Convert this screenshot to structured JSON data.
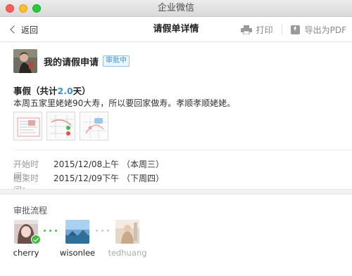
{
  "window": {
    "title": "企业微信"
  },
  "nav": {
    "back_label": "返回",
    "title": "请假单详情",
    "print_label": "打印",
    "export_label": "导出为PDF"
  },
  "applicant": {
    "title": "我的请假申请",
    "status": "审批中"
  },
  "leave": {
    "type_prefix": "事假（共计",
    "days": "2.0",
    "type_suffix": "天）",
    "reason": "本周五家里姥姥90大寿，所以要回家做寿。孝顺孝顺姥姥。"
  },
  "attachments": [
    "attachment-1",
    "attachment-2",
    "attachment-3"
  ],
  "times": {
    "start_label": "开始时间：",
    "start_value": "2015/12/08上午 （本周三）",
    "end_label": "结束时间：",
    "end_value": "2015/12/09下午 （下周四）"
  },
  "flow": {
    "title": "审批流程",
    "approvers": [
      {
        "name": "cherry",
        "status": "approved"
      },
      {
        "name": "wisonlee",
        "status": "current"
      },
      {
        "name": "tedhuang",
        "status": "pending"
      }
    ]
  },
  "colors": {
    "accent": "#3a8fd8",
    "approved": "#4cb84c"
  }
}
